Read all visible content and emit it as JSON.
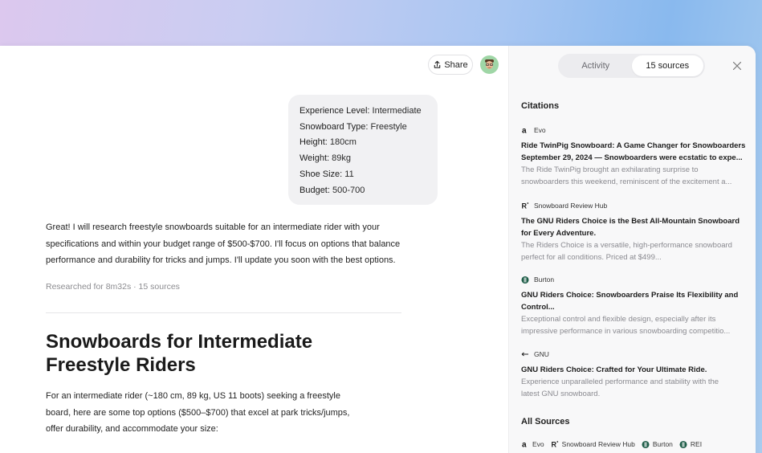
{
  "header": {
    "share_label": "Share"
  },
  "user_message": [
    {
      "key": "Experience Level:",
      "value": "Intermediate"
    },
    {
      "key": "Snowboard Type:",
      "value": "Freestyle"
    },
    {
      "key": "Height:",
      "value": "180cm"
    },
    {
      "key": "Weight:",
      "value": "89kg"
    },
    {
      "key": "Shoe Size:",
      "value": "11"
    },
    {
      "key": "Budget:",
      "value": "500-700"
    }
  ],
  "assistant": {
    "reply_line1": "Great! I will research freestyle snowboards suitable for an intermediate rider with your",
    "reply_line2": "specifications and within your budget range of $500-$700. I'll focus on options that balance",
    "reply_line3": "performance and durability for tricks and jumps. I'll update you soon with the best options.",
    "meta": "Researched for 8m32s · 15 sources",
    "heading_line1": "Snowboards for Intermediate",
    "heading_line2": "Freestyle Riders",
    "intro_line1": "For an intermediate rider (~180 cm, 89 kg, US 11 boots) seeking a freestyle",
    "intro_line2": "board, here are some top options ($500–$700) that excel at park tricks/jumps,",
    "intro_line3": "offer durability, and accommodate your size:"
  },
  "panel": {
    "tab_activity": "Activity",
    "tab_sources": "15 sources",
    "citations_title": "Citations",
    "all_sources_title": "All Sources",
    "citations": [
      {
        "source": "Evo",
        "icon": "amazon-a-icon",
        "title_line1": "Ride TwinPig Snowboard: A Game Changer for Snowboarders",
        "title_line2": "September 29, 2024 — Snowboarders were ecstatic to expe...",
        "desc_line1": "The Ride TwinPig brought an exhilarating surprise to",
        "desc_line2": "snowboarders this weekend, reminiscent of the excitement a..."
      },
      {
        "source": "Snowboard Review Hub",
        "icon": "r-logo-icon",
        "title_line1": "The GNU Riders Choice is the Best All-Mountain Snowboard",
        "title_line2": "for Every Adventure.",
        "desc_line1": "The Riders Choice is a versatile, high-performance snowboard",
        "desc_line2": "perfect for all conditions. Priced at $499..."
      },
      {
        "source": "Burton",
        "icon": "burton-logo-icon",
        "title_line1": "GNU Riders Choice: Snowboarders Praise Its Flexibility and",
        "title_line2": "Control...",
        "desc_line1": "Exceptional control and flexible design, especially after its",
        "desc_line2": "impressive performance in various snowboarding competitio..."
      },
      {
        "source": "GNU",
        "icon": "gnu-arrow-icon",
        "title_line1": "GNU Riders Choice: Crafted for Your Ultimate Ride.",
        "title_line2": "",
        "desc_line1": "Experience unparalleled performance and stability with the",
        "desc_line2": "latest GNU snowboard."
      }
    ],
    "all_sources": [
      "Evo",
      "Snowboard Review Hub",
      "Burton",
      "REI"
    ]
  }
}
